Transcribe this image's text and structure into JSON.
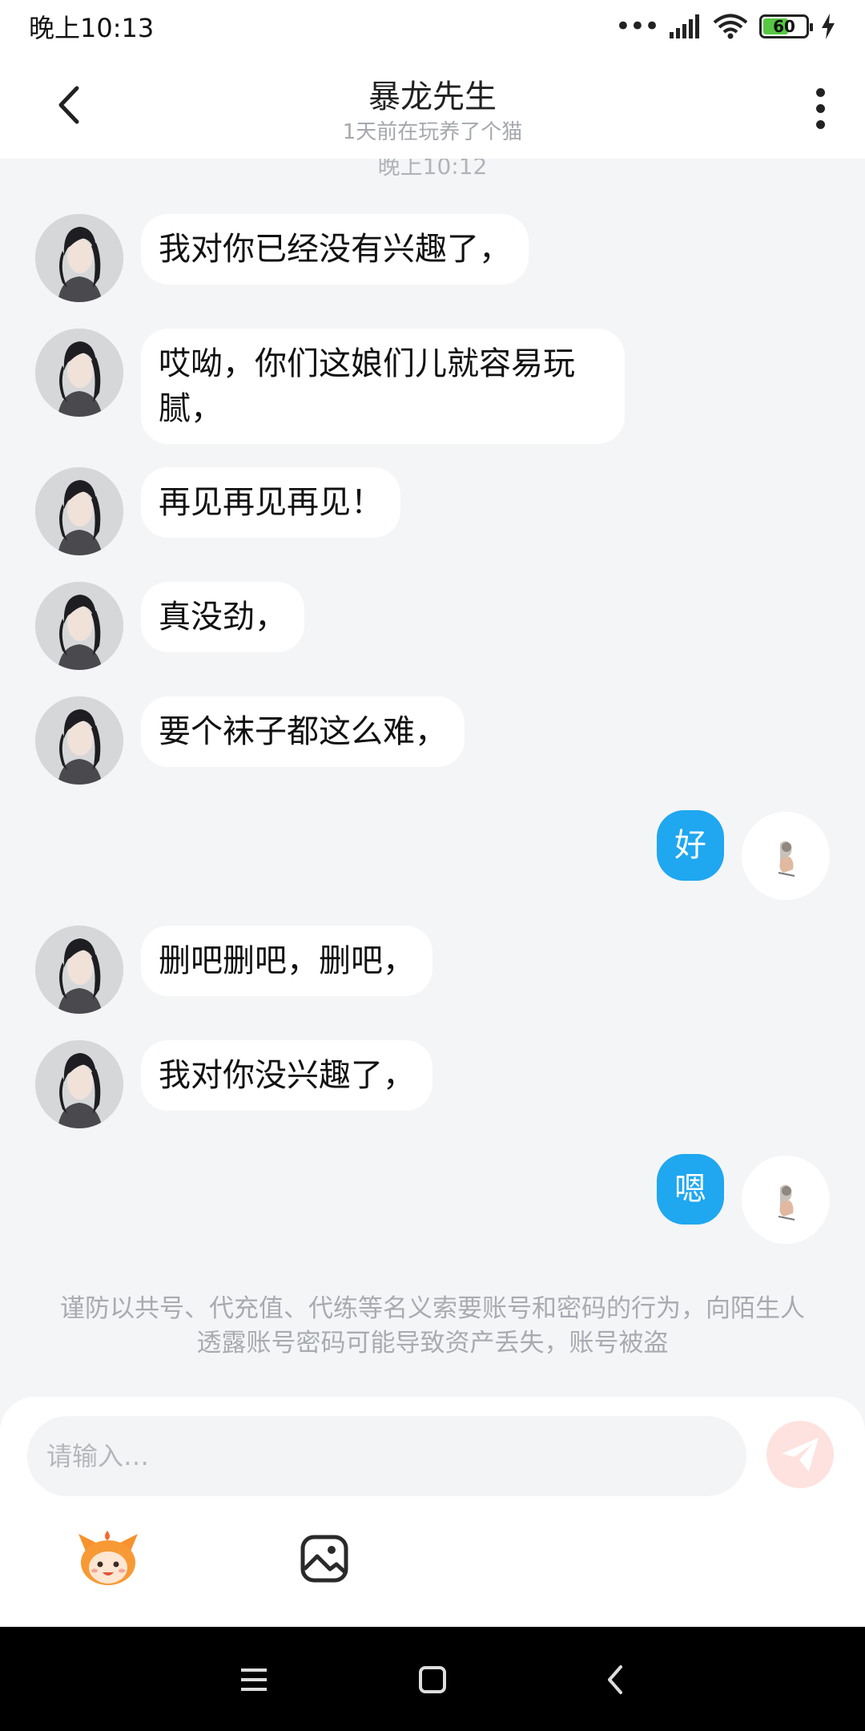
{
  "status_bar": {
    "time": "晚上10:13",
    "signal_dots": "•••",
    "battery_level": "60",
    "battery_fraction": 0.6,
    "battery_color": "#57c744"
  },
  "header": {
    "title": "暴龙先生",
    "subtitle": "1天前在玩养了个猫",
    "back_icon": "chevron-left-icon",
    "more_icon": "more-vertical-icon"
  },
  "chat": {
    "timestamp": "晚上10:12",
    "messages": [
      {
        "side": "left",
        "text": "我对你已经没有兴趣了，"
      },
      {
        "side": "left",
        "text": "哎呦，你们这娘们儿就容易玩腻，"
      },
      {
        "side": "left",
        "text": "再见再见再见！"
      },
      {
        "side": "left",
        "text": "真没劲，"
      },
      {
        "side": "left",
        "text": "要个袜子都这么难，"
      },
      {
        "side": "right",
        "text": "好"
      },
      {
        "side": "left",
        "text": "删吧删吧，删吧，"
      },
      {
        "side": "left",
        "text": "我对你没兴趣了，"
      },
      {
        "side": "right",
        "text": "嗯"
      }
    ]
  },
  "warning": {
    "text": "谨防以共号、代充值、代练等名义索要账号和密码的行为，向陌生人透露账号密码可能导致资产丢失，账号被盗"
  },
  "composer": {
    "placeholder": "请输入…",
    "send_icon": "paper-plane-icon",
    "emoji_icon": "mascot-emoji-icon",
    "image_icon": "image-icon"
  },
  "colors": {
    "accent_blue": "#1fa7f0",
    "send_button": "#fde2df",
    "background": "#f4f5f7"
  },
  "nav_bar": {
    "menu_icon": "menu-icon",
    "home_icon": "home-square-icon",
    "back_icon": "nav-back-icon"
  }
}
